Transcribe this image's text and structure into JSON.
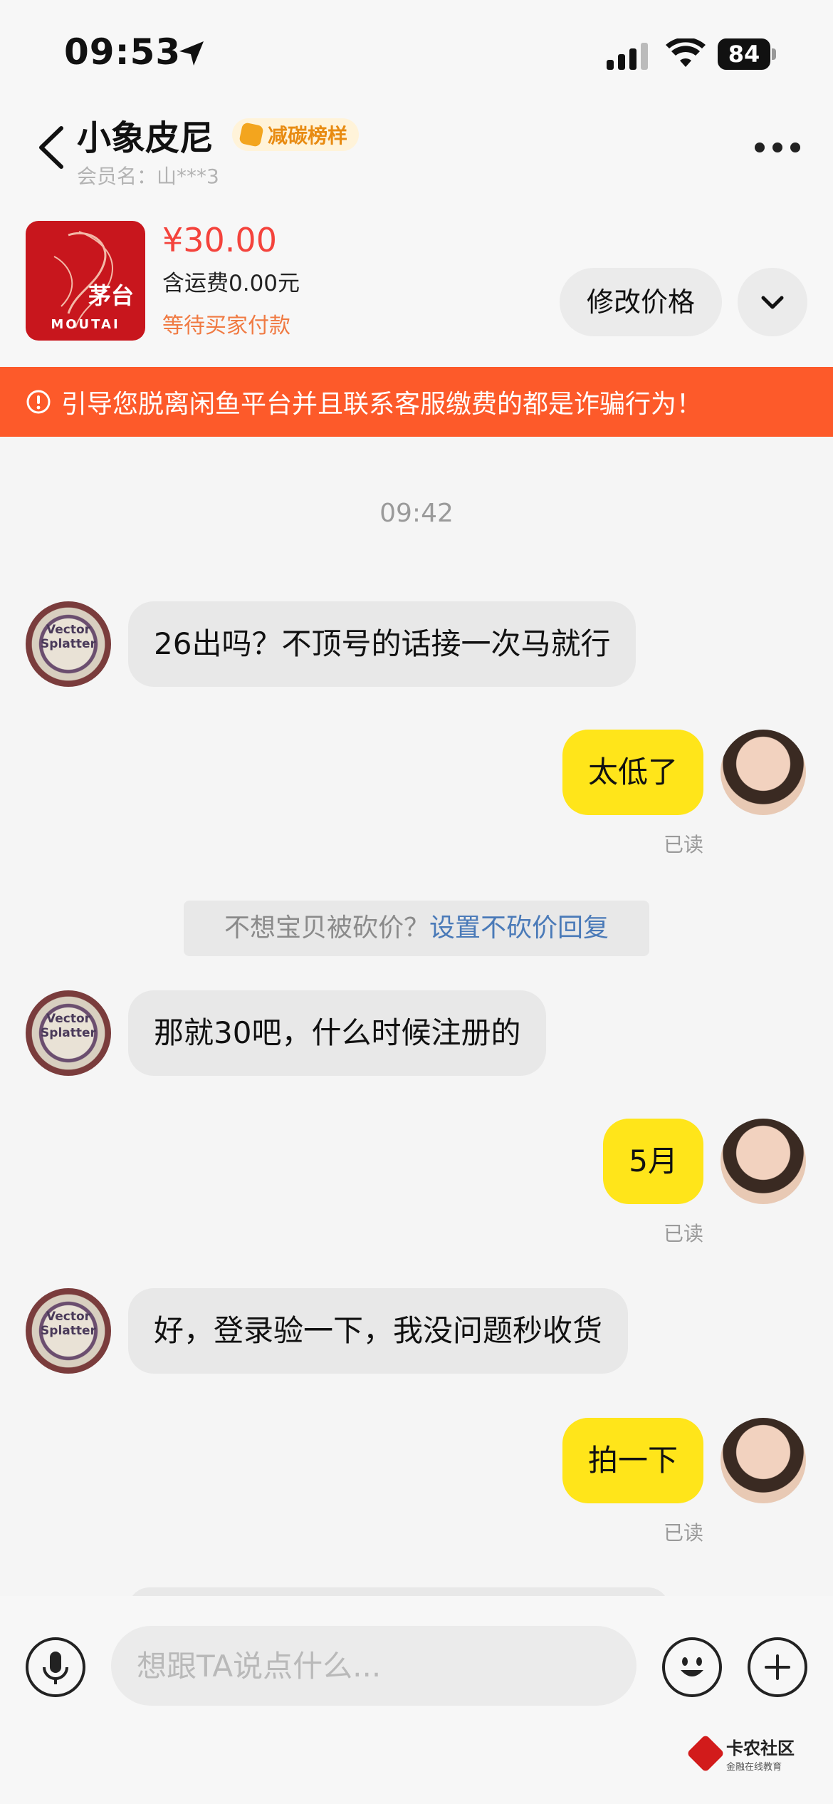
{
  "status_bar": {
    "time": "09:53",
    "battery": "84"
  },
  "header": {
    "title": "小象皮尼",
    "badge": "减碳榜样",
    "member": "会员名：山***3"
  },
  "product": {
    "brand_logo": "MOUTAI",
    "brand_char": "茅台",
    "price": "¥30.00",
    "shipping": "含运费0.00元",
    "status": "等待买家付款",
    "modify_price_label": "修改价格"
  },
  "warning": {
    "text": "引导您脱离闲鱼平台并且联系客服缴费的都是诈骗行为！"
  },
  "chat": {
    "timestamp": "09:42",
    "messages": [
      {
        "side": "in",
        "text": "26出吗？不顶号的话接一次马就行"
      },
      {
        "side": "out",
        "text": "太低了",
        "read": "已读"
      },
      {
        "side": "in",
        "text": "那就30吧，什么时候注册的"
      },
      {
        "side": "out",
        "text": "5月",
        "read": "已读"
      },
      {
        "side": "in",
        "text": "好，登录验一下，我没问题秒收货"
      },
      {
        "side": "out",
        "text": "拍一下",
        "read": "已读"
      }
    ],
    "hint": {
      "question": "不想宝贝被砍价？",
      "link": "设置不砍价回复"
    },
    "avatar_left_text": "Vector Splatter"
  },
  "input": {
    "placeholder": "想跟TA说点什么..."
  },
  "watermark": {
    "main": "卡农社区",
    "sub": "金融在线教育"
  },
  "colors": {
    "accent_yellow": "#ffe51a",
    "warning_orange": "#fd5a2a",
    "price_red": "#f4433c"
  }
}
